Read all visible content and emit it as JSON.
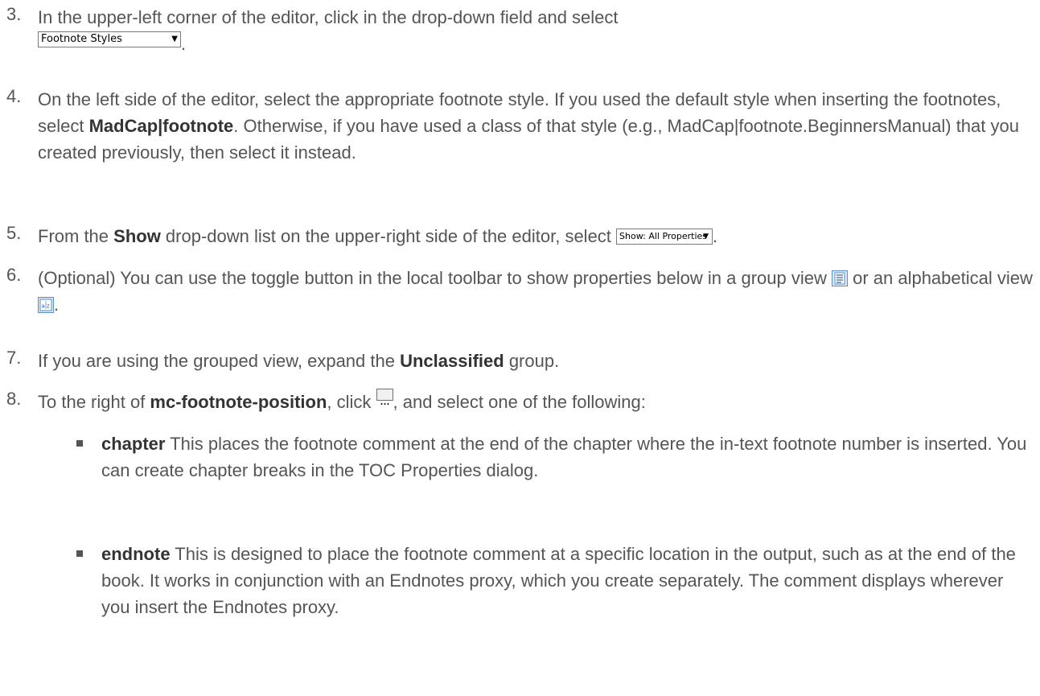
{
  "steps": [
    {
      "number": "3.",
      "text_before": "In the upper-left corner of the editor, click in the drop-down field and select",
      "dropdown_label": "Footnote Styles",
      "text_after": "."
    },
    {
      "number": "4.",
      "text_1": "On the left side of the editor, select the appropriate footnote style. If you used the default style when inserting the footnotes, select ",
      "bold_1": "MadCap|footnote",
      "text_2": ". Otherwise, if you have used a class of that style (e.g., MadCap|footnote.BeginnersManual) that you created previously, then select it instead."
    },
    {
      "number": "5.",
      "text_1": "From the ",
      "bold_1": "Show",
      "text_2": " drop-down list on the upper-right side of the editor, select ",
      "dropdown_label": "Show: All Properties",
      "text_3": "."
    },
    {
      "number": "6.",
      "text_1": "(Optional) You can use the toggle button in the local toolbar to show properties below in a group view ",
      "text_2": " or an alphabetical view ",
      "text_3": "."
    },
    {
      "number": "7.",
      "text_1": "If you are using the grouped view, expand the ",
      "bold_1": "Unclassified",
      "text_2": " group."
    },
    {
      "number": "8.",
      "text_1": "To the right of ",
      "bold_1": "mc-footnote-position",
      "text_2": ", click ",
      "text_3": ", and select one of the following:"
    }
  ],
  "options": [
    {
      "term": "chapter",
      "description": " This places the footnote comment at the end of the chapter where the in-text footnote number is inserted. You can create chapter breaks in the TOC Properties dialog."
    },
    {
      "term": "endnote",
      "description": " This is designed to place the footnote comment at a specific location in the output, such as at the end of the book. It works in conjunction with an Endnotes proxy, which you create separately. The comment displays wherever you insert the Endnotes proxy."
    }
  ],
  "icons": {
    "group_view": "group-view-icon",
    "alphabetical_view": "alphabetical-view-icon",
    "ellipsis_button": "ellipsis-button-icon",
    "dropdown_arrow": "dropdown-arrow-icon"
  },
  "colors": {
    "body_text": "#555555",
    "bold_text": "#333333",
    "icon_accent": "#5b8ec4"
  }
}
